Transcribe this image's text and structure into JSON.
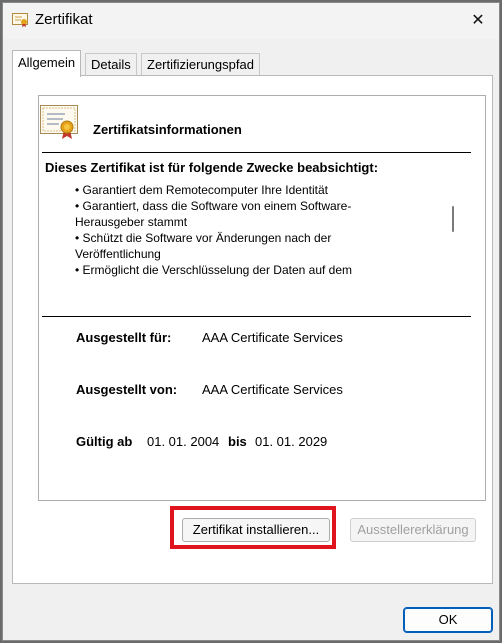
{
  "window": {
    "title": "Zertifikat",
    "close_glyph": "✕"
  },
  "tabs": [
    {
      "label": "Allgemein",
      "active": true
    },
    {
      "label": "Details",
      "active": false
    },
    {
      "label": "Zertifizierungspfad",
      "active": false
    }
  ],
  "cert": {
    "heading": "Zertifikatsinformationen",
    "purpose_heading": "Dieses Zertifikat ist für folgende Zwecke beabsichtigt:",
    "purposes": [
      "• Garantiert dem Remotecomputer Ihre Identität",
      "• Garantiert, dass die Software von einem Software-",
      "Herausgeber stammt",
      "• Schützt die Software vor Änderungen nach der",
      "Veröffentlichung",
      "• Ermöglicht die Verschlüsselung der Daten auf dem"
    ],
    "issued_to_label": "Ausgestellt für:",
    "issued_to_value": "AAA Certificate Services",
    "issued_by_label": "Ausgestellt von:",
    "issued_by_value": "AAA Certificate Services",
    "valid_from_label": "Gültig ab",
    "valid_from": "01. 01. 2004",
    "valid_to_label": "bis",
    "valid_to": "01. 01. 2029"
  },
  "buttons": {
    "install": "Zertifikat installieren...",
    "issuer_statement": "Ausstellererklärung",
    "ok": "OK"
  },
  "colors": {
    "highlight": "#e0141e",
    "accent": "#005fb8"
  }
}
